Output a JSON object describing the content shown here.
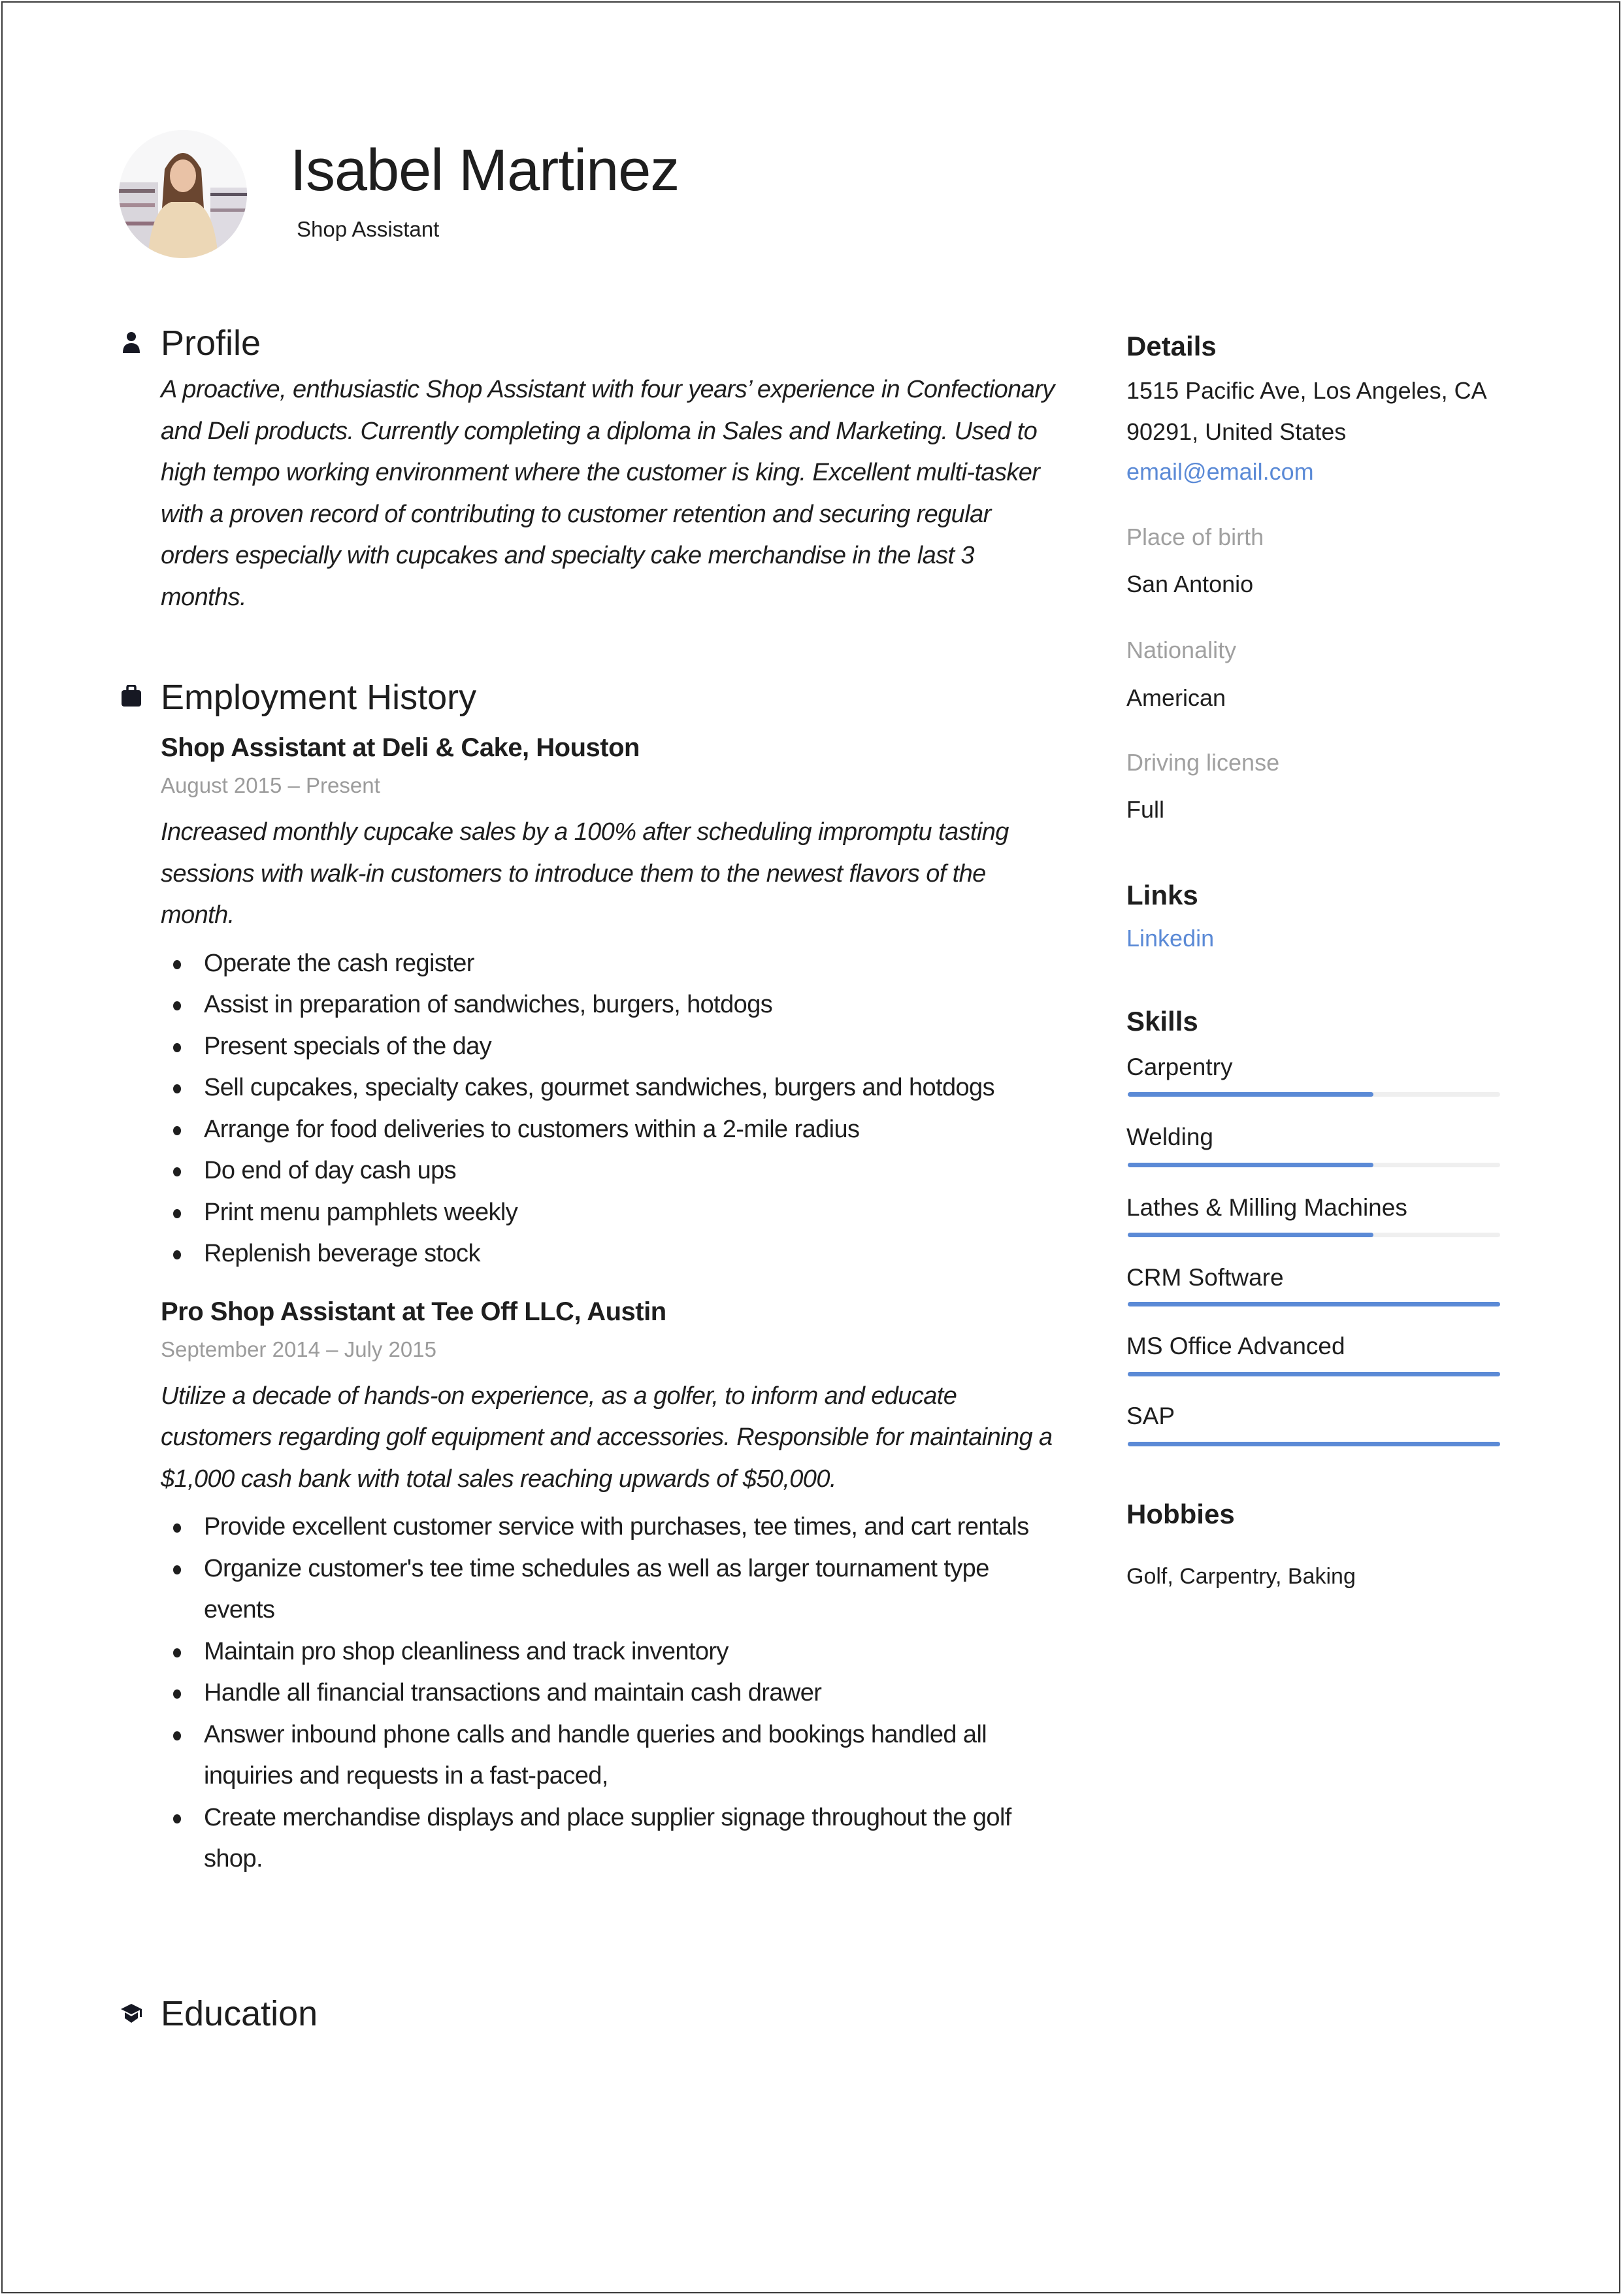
{
  "header": {
    "name": "Isabel Martinez",
    "job_title": "Shop Assistant",
    "photo": "profile-photo"
  },
  "profile": {
    "heading": "Profile",
    "icon": "person-icon",
    "text": "A proactive, enthusiastic Shop Assistant with four years’ experience in Confectionary and Deli products. Currently completing a diploma in Sales and Marketing. Used to high tempo working environment where the customer is king. Excellent multi-tasker with a proven record of contributing to customer retention and securing regular orders especially with cupcakes and specialty cake merchandise in the last 3 months."
  },
  "employment": {
    "heading": "Employment History",
    "icon": "briefcase-icon",
    "jobs": [
      {
        "title": "Shop Assistant at Deli & Cake, Houston",
        "dates": "August 2015  –  Present",
        "summary": "Increased monthly cupcake sales by a 100% after scheduling impromptu tasting sessions with walk-in customers to introduce them to the newest flavors of the month.",
        "bullets": [
          "Operate the cash register",
          "Assist in preparation of sandwiches, burgers, hotdogs",
          "Present specials of the day",
          "Sell cupcakes, specialty cakes, gourmet sandwiches, burgers and hotdogs",
          "Arrange for food deliveries to customers within a 2-mile radius",
          "Do end of day cash ups",
          "Print menu pamphlets weekly",
          "Replenish beverage stock"
        ]
      },
      {
        "title": "Pro Shop Assistant at Tee Off LLC, Austin",
        "dates": "September 2014  –  July 2015",
        "summary": "Utilize a decade of hands-on experience, as a golfer, to inform and educate customers regarding golf equipment and accessories. Responsible for maintaining a $1,000 cash bank with total sales reaching upwards of $50,000.",
        "bullets": [
          "Provide excellent customer service with purchases, tee times, and cart rentals",
          "Organize customer's tee time schedules as well as larger tournament type events",
          "Maintain pro shop cleanliness and track inventory",
          "Handle all financial transactions and maintain cash drawer",
          "Answer inbound phone calls and handle queries and bookings handled all inquiries and requests in a fast-paced,",
          "Create merchandise displays and place supplier signage throughout the golf shop."
        ]
      }
    ]
  },
  "education": {
    "heading": "Education",
    "icon": "graduation-cap-icon"
  },
  "details": {
    "heading": "Details",
    "address_line1": "1515 Pacific Ave, Los Angeles, CA",
    "address_line2": "90291, United States",
    "email": "email@email.com",
    "place_of_birth_label": "Place of birth",
    "place_of_birth": "San Antonio",
    "nationality_label": "Nationality",
    "nationality": "American",
    "driving_license_label": "Driving license",
    "driving_license": "Full"
  },
  "links": {
    "heading": "Links",
    "items": [
      "Linkedin"
    ]
  },
  "skills": {
    "heading": "Skills",
    "items": [
      {
        "name": "Carpentry",
        "level": 0.66
      },
      {
        "name": "Welding",
        "level": 0.66
      },
      {
        "name": "Lathes & Milling Machines",
        "level": 0.66
      },
      {
        "name": "CRM Software",
        "level": 1.0
      },
      {
        "name": "MS Office Advanced",
        "level": 1.0
      },
      {
        "name": "SAP",
        "level": 1.0
      }
    ]
  },
  "hobbies": {
    "heading": "Hobbies",
    "text": "Golf, Carpentry, Baking"
  },
  "colors": {
    "accent": "#5b8ad6",
    "text": "#1e1e1e",
    "muted": "#9b9b9b",
    "track": "#efefef"
  }
}
